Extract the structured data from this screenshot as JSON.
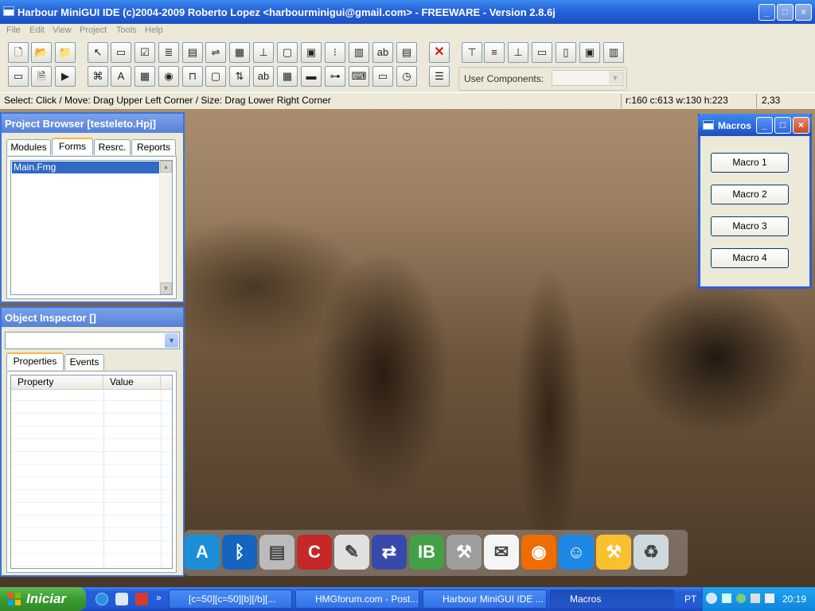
{
  "window": {
    "title": "Harbour MiniGUI IDE (c)2004-2009 Roberto Lopez <harbourminigui@gmail.com> - FREEWARE - Version 2.8.6j"
  },
  "menu": [
    "File",
    "Edit",
    "View",
    "Project",
    "Tools",
    "Help"
  ],
  "toolbar": {
    "row1_icons": [
      "new-file-icon",
      "open-folder-icon",
      "open-project-icon",
      "pointer-icon",
      "button-control-icon",
      "checkbox-control-icon",
      "list-control-icon",
      "combo-control-icon",
      "date-control-icon",
      "grid-control-icon",
      "label-control-icon",
      "frame-control-icon",
      "image-control-icon",
      "tree-control-icon",
      "browse-control-icon",
      "textbox-control-icon",
      "editbox-control-icon",
      "delete-icon",
      "align-top-icon",
      "align-center-icon",
      "align-bottom-icon",
      "same-width-icon",
      "same-height-icon",
      "same-size-icon",
      "order-icon"
    ],
    "row2_icons": [
      "form-icon",
      "report-icon",
      "run-icon",
      "project-icon",
      "font-icon",
      "table-icon",
      "radio-control-icon",
      "tab-control-icon",
      "page-icon",
      "spinner-control-icon",
      "edit-label-icon",
      "calendar-control-icon",
      "progress-control-icon",
      "slider-control-icon",
      "hotkey-control-icon",
      "panel-control-icon",
      "timer-control-icon",
      "list-order-icon"
    ],
    "user_components_label": "User Components:",
    "user_components_value": ""
  },
  "status": {
    "hint": "Select: Click / Move: Drag Upper Left Corner / Size: Drag Lower Right Corner",
    "geometry": "r:160 c:613 w:130 h:223",
    "cursor": "2,33"
  },
  "project_browser": {
    "title": "Project Browser [testeleto.Hpj]",
    "tabs": [
      "Modules",
      "Forms",
      "Resrc.",
      "Reports"
    ],
    "active_tab": "Forms",
    "items": [
      "Main.Fmg"
    ]
  },
  "object_inspector": {
    "title": "Object Inspector []",
    "selector_value": "",
    "tabs": [
      "Properties",
      "Events"
    ],
    "columns": [
      "Property",
      "Value"
    ]
  },
  "macros": {
    "title": "Macros",
    "buttons": [
      "Macro 1",
      "Macro 2",
      "Macro 3",
      "Macro 4"
    ]
  },
  "taskbar": {
    "start_label": "Iniciar",
    "chevron": "»",
    "tasks": [
      {
        "label": "[c=50][c=50][b][/b][...",
        "active": false
      },
      {
        "label": "HMGforum.com - Post...",
        "active": false
      },
      {
        "label": "Harbour MiniGUI IDE ...",
        "active": false
      },
      {
        "label": "Macros",
        "active": true
      }
    ],
    "language": "PT",
    "clock": "20:19"
  },
  "dock_icons": [
    "arch-linux-icon",
    "bluetooth-icon",
    "notepad-icon",
    "ccleaner-icon",
    "text-editor-icon",
    "network-icon",
    "ib-icon",
    "tools-icon",
    "mail-icon",
    "firefox-icon",
    "messenger-icon",
    "hammer-icon",
    "recycle-bin-icon"
  ]
}
